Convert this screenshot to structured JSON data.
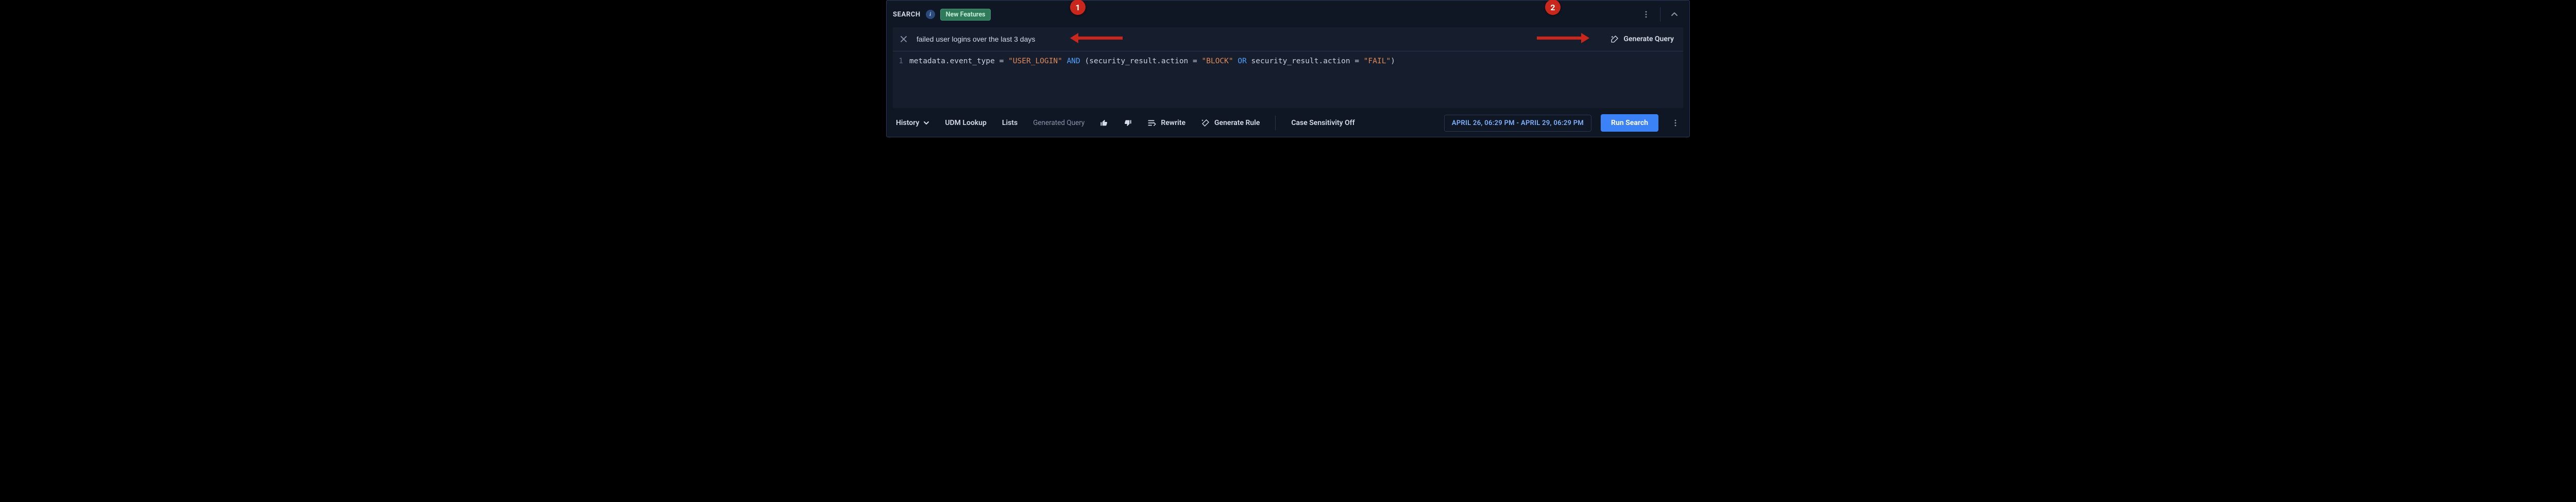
{
  "header": {
    "search_label": "SEARCH",
    "new_features_label": "New Features"
  },
  "nl": {
    "input_value": "failed user logins over the last 3 days",
    "generate_label": "Generate Query"
  },
  "editor": {
    "line_no": "1",
    "tokens": {
      "f1": "metadata.event_type",
      "eq": " = ",
      "s1": "\"USER_LOGIN\"",
      "and": " AND ",
      "lp": "(",
      "f2": "security_result.action",
      "s2": "\"BLOCK\"",
      "or": " OR ",
      "f3": "security_result.action",
      "s3": "\"FAIL\"",
      "rp": ")"
    }
  },
  "bottom": {
    "history": "History",
    "udm": "UDM Lookup",
    "lists": "Lists",
    "generated": "Generated Query",
    "rewrite": "Rewrite",
    "gen_rule": "Generate Rule",
    "case": "Case Sensitivity Off",
    "daterange": "APRIL 26, 06:29 PM - APRIL 29, 06:29 PM",
    "run": "Run Search"
  },
  "annotations": {
    "one": "1",
    "two": "2"
  }
}
